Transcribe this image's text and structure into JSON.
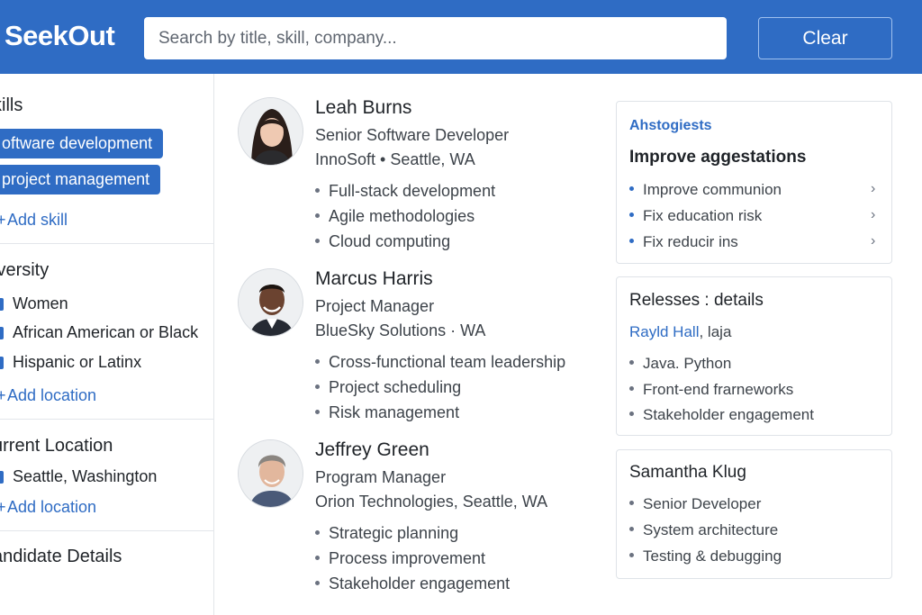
{
  "header": {
    "logo": "SeekOut",
    "search_placeholder": "Search by title, skill, company...",
    "clear_label": "Clear"
  },
  "sidebar": {
    "skills": {
      "title": "kills",
      "chips": [
        "oftware development",
        "project management"
      ],
      "add_label": "Add skill"
    },
    "diversity": {
      "title": "iversity",
      "options": [
        "Women",
        "African American or Black",
        "Hispanic or Latinx"
      ],
      "add_label": "Add location"
    },
    "current_location": {
      "title": "urrent Location",
      "options": [
        "Seattle, Washington"
      ],
      "add_label": "Add location"
    },
    "candidate_details": {
      "title": "andidate Details"
    }
  },
  "candidates": [
    {
      "name": "Leah Burns",
      "title": "Senior Software Developer",
      "location": "InnoSoft  •  Seattle, WA",
      "skills": [
        "Full-stack development",
        "Agile methodologies",
        "Cloud computing"
      ]
    },
    {
      "name": "Marcus Harris",
      "title": "Project Manager",
      "location": "BlueSky Solutions  ·  WA",
      "skills": [
        "Cross-functional team leadership",
        "Project scheduling",
        "Risk management"
      ]
    },
    {
      "name": "Jeffrey Green",
      "title": "Program Manager",
      "location": "Orion Technologies, Seattle, WA",
      "skills": [
        "Strategic planning",
        "Process improvement",
        "Stakeholder engagement"
      ]
    }
  ],
  "cards": {
    "suggestions": {
      "kicker": "Ahstogiests",
      "title": "Improve aggestations",
      "items": [
        "Improve communion",
        "Fix education risk",
        "Fix reducir ins"
      ]
    },
    "releases": {
      "title": "Relesses : details",
      "link_name": "Rayld Hall",
      "link_suffix": ", laja",
      "items": [
        "Java. Python",
        "Front-end frarneworks",
        "Stakeholder engagement"
      ]
    },
    "samantha": {
      "title": "Samantha Klug",
      "items": [
        "Senior Developer",
        "System architecture",
        "Testing & debugging"
      ]
    }
  },
  "colors": {
    "brand_blue": "#2f6cc4",
    "border": "#dfe3e8"
  }
}
